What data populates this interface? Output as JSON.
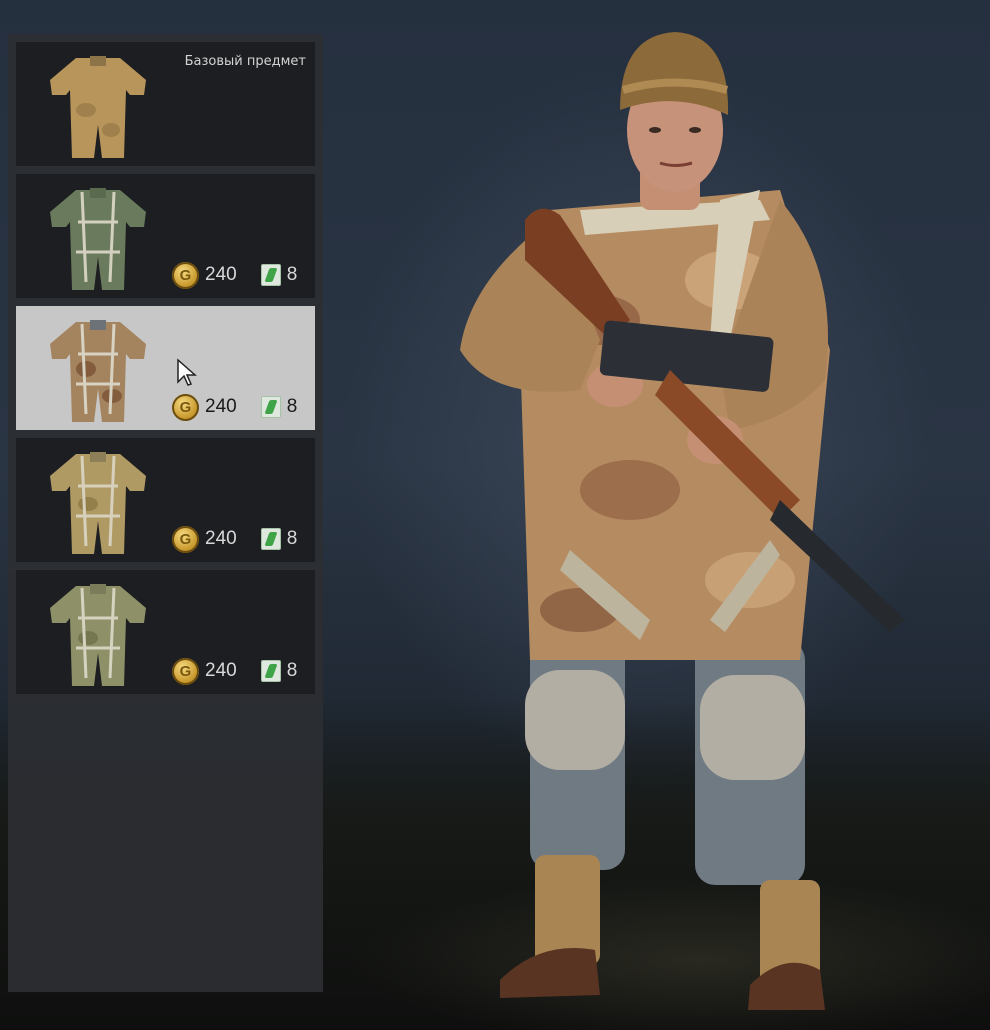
{
  "items": [
    {
      "id": "base",
      "label": "Базовый предмет",
      "price": null,
      "orders": null,
      "camo": "tan"
    },
    {
      "id": "camo-green",
      "label": "",
      "price": "240",
      "orders": "8",
      "camo": "green"
    },
    {
      "id": "camo-brown",
      "label": "",
      "price": "240",
      "orders": "8",
      "camo": "brown"
    },
    {
      "id": "camo-yellow",
      "label": "",
      "price": "240",
      "orders": "8",
      "camo": "yellow"
    },
    {
      "id": "camo-olive",
      "label": "",
      "price": "240",
      "orders": "8",
      "camo": "olive"
    }
  ],
  "selected_index": 2,
  "icons": {
    "currency": "gold-coin-icon",
    "orders": "order-ticket-icon"
  },
  "colors": {
    "panel": "#2c2e32",
    "item_bg": "#1c1e21",
    "item_selected": "#c7c7c7",
    "gold": "#c99a2e",
    "order": "#3fa348"
  }
}
